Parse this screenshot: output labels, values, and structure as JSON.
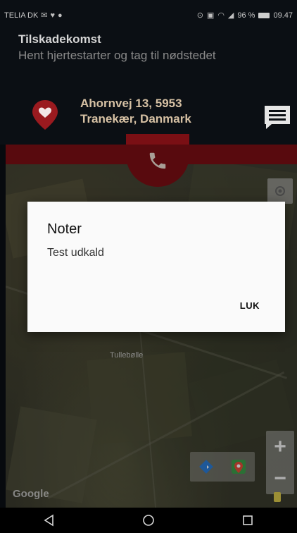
{
  "status": {
    "carrier": "TELIA DK",
    "battery": "96 %",
    "time": "09.47"
  },
  "header": {
    "title": "Tilskadekomst",
    "subtitle": "Hent hjertestarter og tag til nødstedet",
    "address_line1": "Ahornvej 13, 5953",
    "address_line2": "Tranekær, Danmark"
  },
  "map": {
    "labels": [
      "Tullebølle"
    ],
    "attribution": "Google"
  },
  "dialog": {
    "title": "Noter",
    "body": "Test udkald",
    "close_label": "LUK"
  },
  "colors": {
    "accent_red": "#7a0f14",
    "address_text": "#d6c1a4"
  },
  "icons": {
    "pin": "heart-pin-icon",
    "notes": "message-icon",
    "call": "phone-icon",
    "locate": "my-location-icon",
    "nav_back": "back-triangle-icon",
    "nav_home": "home-circle-icon",
    "nav_recent": "recent-square-icon"
  }
}
